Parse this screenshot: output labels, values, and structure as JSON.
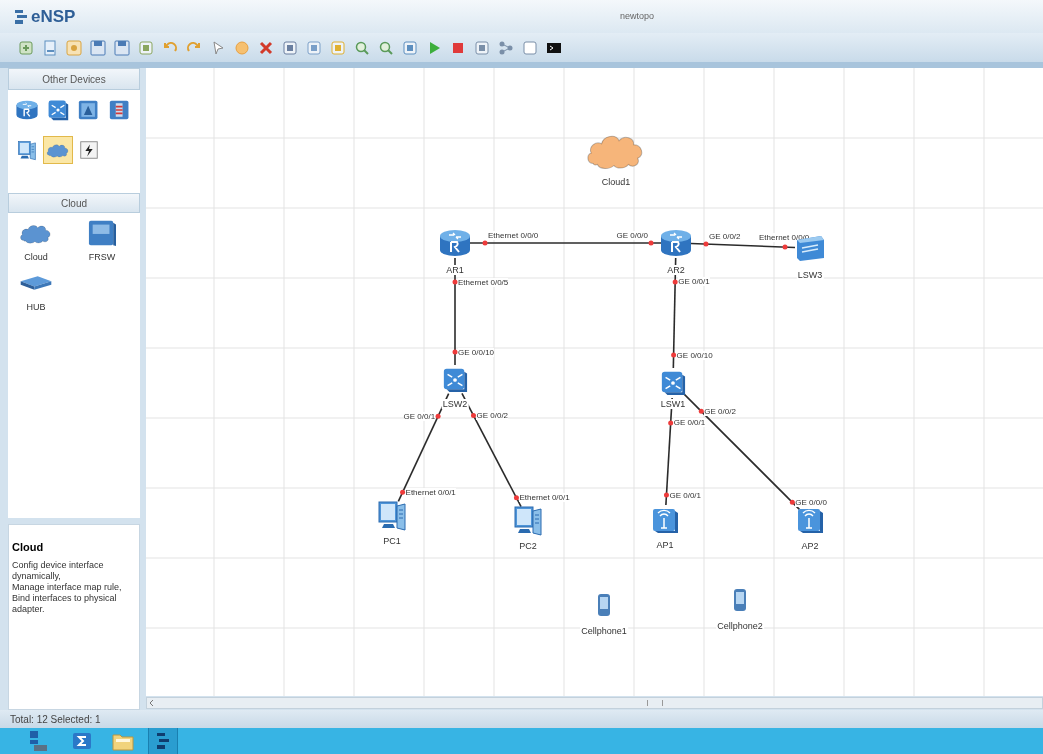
{
  "window": {
    "app": "eNSP",
    "title": "newtopo"
  },
  "palette": {
    "other_devices": {
      "title": "Other Devices",
      "items": [
        {
          "kind": "router",
          "selected": false
        },
        {
          "kind": "switch",
          "selected": false
        },
        {
          "kind": "wlan",
          "selected": false
        },
        {
          "kind": "firewall",
          "selected": false
        },
        {
          "kind": "pc",
          "selected": false
        },
        {
          "kind": "cloud",
          "selected": true
        },
        {
          "kind": "power",
          "selected": false
        }
      ]
    },
    "cloud": {
      "title": "Cloud",
      "items": [
        {
          "kind": "cloud",
          "label": "Cloud"
        },
        {
          "kind": "frsw",
          "label": "FRSW"
        },
        {
          "kind": "hub",
          "label": "HUB"
        }
      ]
    }
  },
  "description": {
    "title": "Cloud",
    "lines": [
      "Config device interface dynamically,",
      "Manage interface map rule,",
      "Bind interfaces to physical adapter."
    ]
  },
  "canvas": {
    "nodes": [
      {
        "kind": "cloud",
        "label": "Cloud1"
      },
      {
        "kind": "router",
        "label": "AR1"
      },
      {
        "kind": "router",
        "label": "AR2"
      },
      {
        "kind": "switch-l2",
        "label": "LSW3"
      },
      {
        "kind": "switch",
        "label": "LSW2"
      },
      {
        "kind": "switch",
        "label": "LSW1"
      },
      {
        "kind": "pc",
        "label": "PC1"
      },
      {
        "kind": "pc",
        "label": "PC2"
      },
      {
        "kind": "ap",
        "label": "AP1"
      },
      {
        "kind": "ap",
        "label": "AP2"
      },
      {
        "kind": "phone",
        "label": "Cellphone1"
      },
      {
        "kind": "phone",
        "label": "Cellphone2"
      }
    ],
    "links": [
      {
        "from_port": "Ethernet 0/0/0",
        "to_port": "GE 0/0/0"
      },
      {
        "from_port": "GE 0/0/2",
        "to_port": "Ethernet 0/0/0"
      },
      {
        "from_port": "Ethernet 0/0/5",
        "to_port": "GE 0/0/10"
      },
      {
        "from_port": "GE 0/0/1",
        "to_port": "GE 0/0/10"
      },
      {
        "from_port": "GE 0/0/1",
        "to_port": "Ethernet 0/0/1"
      },
      {
        "from_port": "GE 0/0/2",
        "to_port": "Ethernet 0/0/1"
      },
      {
        "from_port": "GE 0/0/1",
        "to_port": "GE 0/0/1"
      },
      {
        "from_port": "GE 0/0/2",
        "to_port": "GE 0/0/0"
      }
    ]
  },
  "status_bar": {
    "text": "Total: 12 Selected: 1"
  }
}
